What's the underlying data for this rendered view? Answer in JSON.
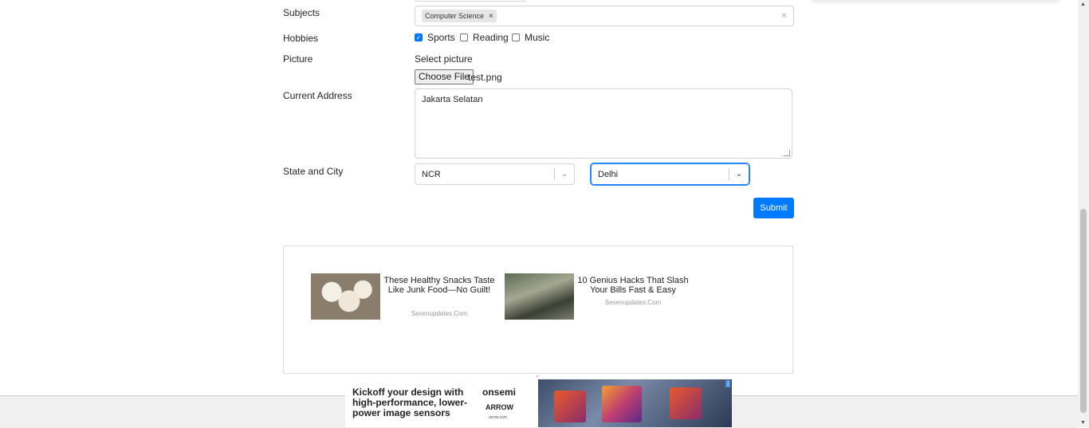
{
  "form": {
    "subjects": {
      "label": "Subjects",
      "chips": [
        "Computer Science"
      ],
      "chip_remove": "×",
      "clear": "×"
    },
    "hobbies": {
      "label": "Hobbies",
      "options": [
        {
          "label": "Sports",
          "checked": true
        },
        {
          "label": "Reading",
          "checked": false
        },
        {
          "label": "Music",
          "checked": false
        }
      ]
    },
    "picture": {
      "label": "Picture",
      "hint": "Select picture",
      "button": "Choose File",
      "file_name": "test.png"
    },
    "address": {
      "label": "Current Address",
      "value": "Jakarta Selatan"
    },
    "state_city": {
      "label": "State and City",
      "state": "NCR",
      "city": "Delhi"
    },
    "submit": "Submit"
  },
  "ads": {
    "items": [
      {
        "title": "These Healthy Snacks Taste Like Junk Food—No Guilt!",
        "source": "Sevenupdates.Com"
      },
      {
        "title": "10 Genius Hacks That Slash Your Bills Fast & Easy",
        "source": "Sevenupdates.Com"
      }
    ],
    "banner": {
      "text": "Kickoff your design with high-performance, lower-power image sensors",
      "brand1": "onsemi",
      "brand2": "ARROW",
      "brand3": "arrow.com"
    }
  },
  "colors": {
    "primary": "#007bff",
    "focus": "#2684ff",
    "checkbox": "#0075ff"
  }
}
